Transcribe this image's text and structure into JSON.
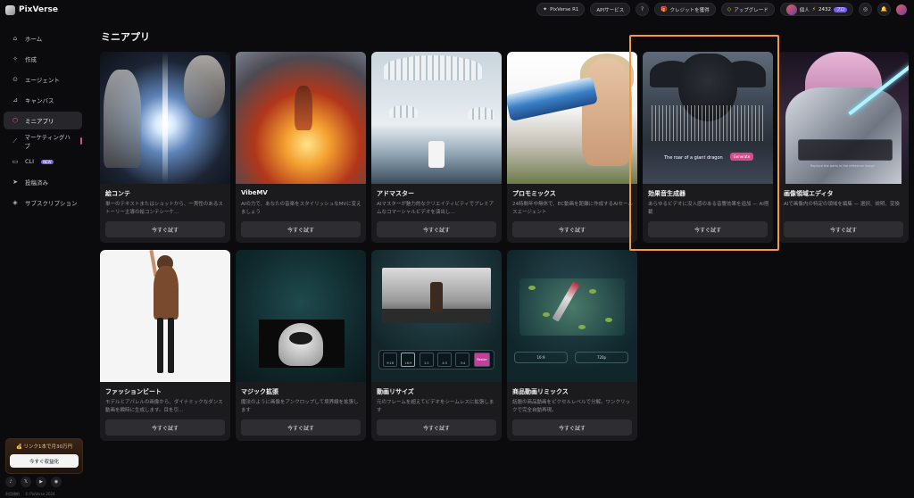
{
  "app": {
    "name": "PixVerse"
  },
  "topbar": {
    "model_label": "PixVerse R1",
    "api_label": "APIサービス",
    "credit_promo_label": "クレジットを獲得",
    "upgrade_label": "アップグレード",
    "account_label": "個人",
    "credits": "2432",
    "plan_badge": "プロ"
  },
  "sidebar": {
    "items": [
      {
        "label": "ホーム",
        "icon": "home-icon"
      },
      {
        "label": "作成",
        "icon": "sparkle-icon"
      },
      {
        "label": "エージェント",
        "icon": "agent-icon"
      },
      {
        "label": "キャンバス",
        "icon": "canvas-icon"
      },
      {
        "label": "ミニアプリ",
        "icon": "cube-icon",
        "active": true
      },
      {
        "label": "マーケティングハブ",
        "icon": "chart-icon"
      },
      {
        "label": "CLI",
        "icon": "terminal-icon",
        "badge": "NEW"
      },
      {
        "label": "投稿済み",
        "icon": "send-icon"
      },
      {
        "label": "サブスクリプション",
        "icon": "tag-icon"
      }
    ],
    "promo_text": "💰 リンク1本で月30万円",
    "promo_button": "今すぐ収益化",
    "footer": [
      "利用規約",
      "© PixVerse 2024"
    ]
  },
  "main": {
    "title": "ミニアプリ",
    "cards": [
      {
        "title": "絵コンテ",
        "desc": "単一のテキストまたはショットから、一貫性のあるストーリー主導の絵コンテシーケ…",
        "button": "今すぐ試す"
      },
      {
        "title": "VibeMV",
        "desc": "AIの力で、あなたの音楽をスタイリッシュなMVに変えましょう",
        "button": "今すぐ試す"
      },
      {
        "title": "アドマスター",
        "desc": "AIマスターが魅力的なクリエイティビティでプレミアムなコマーシャルビデオを演出し…",
        "button": "今すぐ試す"
      },
      {
        "title": "プロモミックス",
        "desc": "24時間年中無休で、EC動画を距離に作成するAIセールスエージェント",
        "button": "今すぐ試す"
      },
      {
        "title": "効果音生成器",
        "desc": "あらゆるビデオに没入感のある音響効果を追加 — AI搭載",
        "button": "今すぐ試す",
        "thumb_caption": "The roar of a giant dragon",
        "thumb_button": "Generate"
      },
      {
        "title": "画像領域エディタ",
        "desc": "AIで画像内の特定の領域を編集 — 選択、説明、変換",
        "button": "今すぐ試す",
        "thumb_caption": "Replace the parts in the reference image"
      },
      {
        "title": "ファッションビート",
        "desc": "モデルとアパレルの画像から、ダイナミックなダンス動画を瞬時に生成します。目を引…",
        "button": "今すぐ試す"
      },
      {
        "title": "マジック拡張",
        "desc": "魔法のように画像をアンクロップして境界線を拡張します",
        "button": "今すぐ試す"
      },
      {
        "title": "動画リサイズ",
        "desc": "元のフレームを超えてビデオをシームレスに拡張します",
        "button": "今すぐ試す",
        "ratios": [
          "9:16",
          "16:9",
          "1:1",
          "4:3",
          "3:4"
        ],
        "thumb_button": "Resize"
      },
      {
        "title": "商品動画リミックス",
        "desc": "話題の商品動画をピクセルレベルで分解。ワンクリックで完全自動再現。",
        "button": "今すぐ試す",
        "options": [
          "16:9",
          "720p"
        ]
      }
    ]
  },
  "colors": {
    "accent": "#7b5cff",
    "highlight": "#f29b3d",
    "background": "#0b0b0d",
    "card": "#1b1b1e"
  }
}
